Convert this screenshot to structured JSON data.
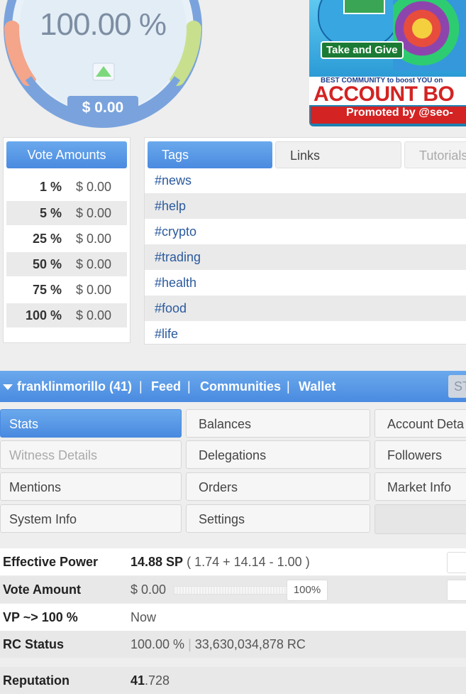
{
  "gauge": {
    "value": "100.00 %",
    "dollar": "$ 0.00",
    "level": 1.0,
    "colors": {
      "left": "#f4a58a",
      "right": "#c8e08e",
      "ring": "#7aa3dd",
      "face": "#e9f1f8",
      "arrow": "#7dd87d"
    }
  },
  "ad": {
    "take_and_give": "Take and Give",
    "best_line": "BEST COMMUNITY to boost YOU on",
    "account_line": "ACCOUNT BO",
    "promoted_line": "Promoted by @seo-"
  },
  "vote_amounts": {
    "header": "Vote Amounts",
    "rows": [
      {
        "pct": "1 %",
        "value": "$ 0.00"
      },
      {
        "pct": "5 %",
        "value": "$ 0.00"
      },
      {
        "pct": "25 %",
        "value": "$ 0.00"
      },
      {
        "pct": "50 %",
        "value": "$ 0.00"
      },
      {
        "pct": "75 %",
        "value": "$ 0.00"
      },
      {
        "pct": "100 %",
        "value": "$ 0.00"
      }
    ]
  },
  "tags_panel": {
    "tabs": [
      "Tags",
      "Links",
      "Tutorials"
    ],
    "tags": [
      "#news",
      "#help",
      "#crypto",
      "#trading",
      "#health",
      "#food",
      "#life"
    ]
  },
  "user_bar": {
    "username": "franklinmorillo (41)",
    "sep": "|",
    "feed": "Feed",
    "communities": "Communities",
    "wallet": "Wallet",
    "steem_button": "ST"
  },
  "nav": {
    "stats": "Stats",
    "balances": "Balances",
    "account_details": "Account Deta",
    "witness_details": "Witness Details",
    "delegations": "Delegations",
    "followers": "Followers",
    "mentions": "Mentions",
    "orders": "Orders",
    "market_info": "Market Info",
    "system_info": "System Info",
    "settings": "Settings"
  },
  "stats": {
    "effective_power_label": "Effective Power",
    "effective_power_value": "14.88 SP",
    "effective_power_detail": "( 1.74 + 14.14 - 1.00 )",
    "vote_amount_label": "Vote Amount",
    "vote_amount_value": "$ 0.00",
    "vote_amount_pct": "100%",
    "vp_label": "VP ~> 100 %",
    "vp_value": "Now",
    "rc_label": "RC Status",
    "rc_pct": "100.00 %",
    "rc_sep": "|",
    "rc_amount": "33,630,034,878 RC",
    "reputation_label": "Reputation",
    "reputation_int": "41",
    "reputation_dec": ".728"
  }
}
